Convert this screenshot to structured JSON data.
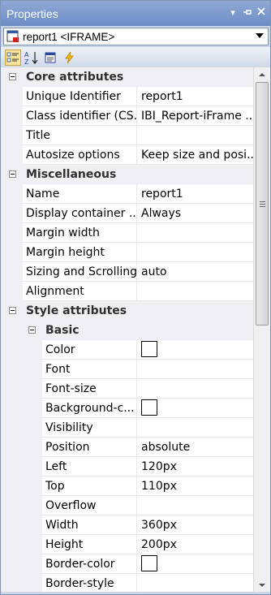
{
  "window": {
    "title": "Properties"
  },
  "selector": {
    "value": "report1 <IFRAME>"
  },
  "toolbar": {
    "buttons": [
      {
        "name": "categorized-button",
        "icon": "categorized-icon",
        "active": true
      },
      {
        "name": "alphabetical-button",
        "icon": "sort-az-icon",
        "active": false
      },
      {
        "name": "property-pages-button",
        "icon": "property-pages-icon",
        "active": false
      },
      {
        "name": "events-button",
        "icon": "lightning-icon",
        "active": false
      }
    ]
  },
  "categories": {
    "core": {
      "label": "Core attributes"
    },
    "misc": {
      "label": "Miscellaneous"
    },
    "style": {
      "label": "Style attributes"
    },
    "basic": {
      "label": "Basic"
    }
  },
  "properties": {
    "core": [
      {
        "name": "Unique Identifier",
        "value": "report1"
      },
      {
        "name": "Class identifier (CS...",
        "value": "IBI_Report-iFrame ..."
      },
      {
        "name": "Title",
        "value": ""
      },
      {
        "name": "Autosize options",
        "value": "Keep size and posi..."
      }
    ],
    "misc": [
      {
        "name": "Name",
        "value": "report1"
      },
      {
        "name": "Display container ...",
        "value": "Always"
      },
      {
        "name": "Margin width",
        "value": ""
      },
      {
        "name": "Margin height",
        "value": ""
      },
      {
        "name": "Sizing and Scrolling",
        "value": "auto"
      },
      {
        "name": "Alignment",
        "value": ""
      }
    ],
    "basic": [
      {
        "name": "Color",
        "value": ""
      },
      {
        "name": "Font",
        "value": ""
      },
      {
        "name": "Font-size",
        "value": ""
      },
      {
        "name": "Background-c...",
        "value": ""
      },
      {
        "name": "Visibility",
        "value": ""
      },
      {
        "name": "Position",
        "value": "absolute"
      },
      {
        "name": "Left",
        "value": "120px"
      },
      {
        "name": "Top",
        "value": "110px"
      },
      {
        "name": "Overflow",
        "value": ""
      },
      {
        "name": "Width",
        "value": "360px"
      },
      {
        "name": "Height",
        "value": "200px"
      },
      {
        "name": "Border-color",
        "value": ""
      },
      {
        "name": "Border-style",
        "value": ""
      }
    ]
  },
  "colors": {
    "title_bar": "#7b97cc",
    "category_bg": "#f0f0f4",
    "active_button": "#fbe39a"
  }
}
